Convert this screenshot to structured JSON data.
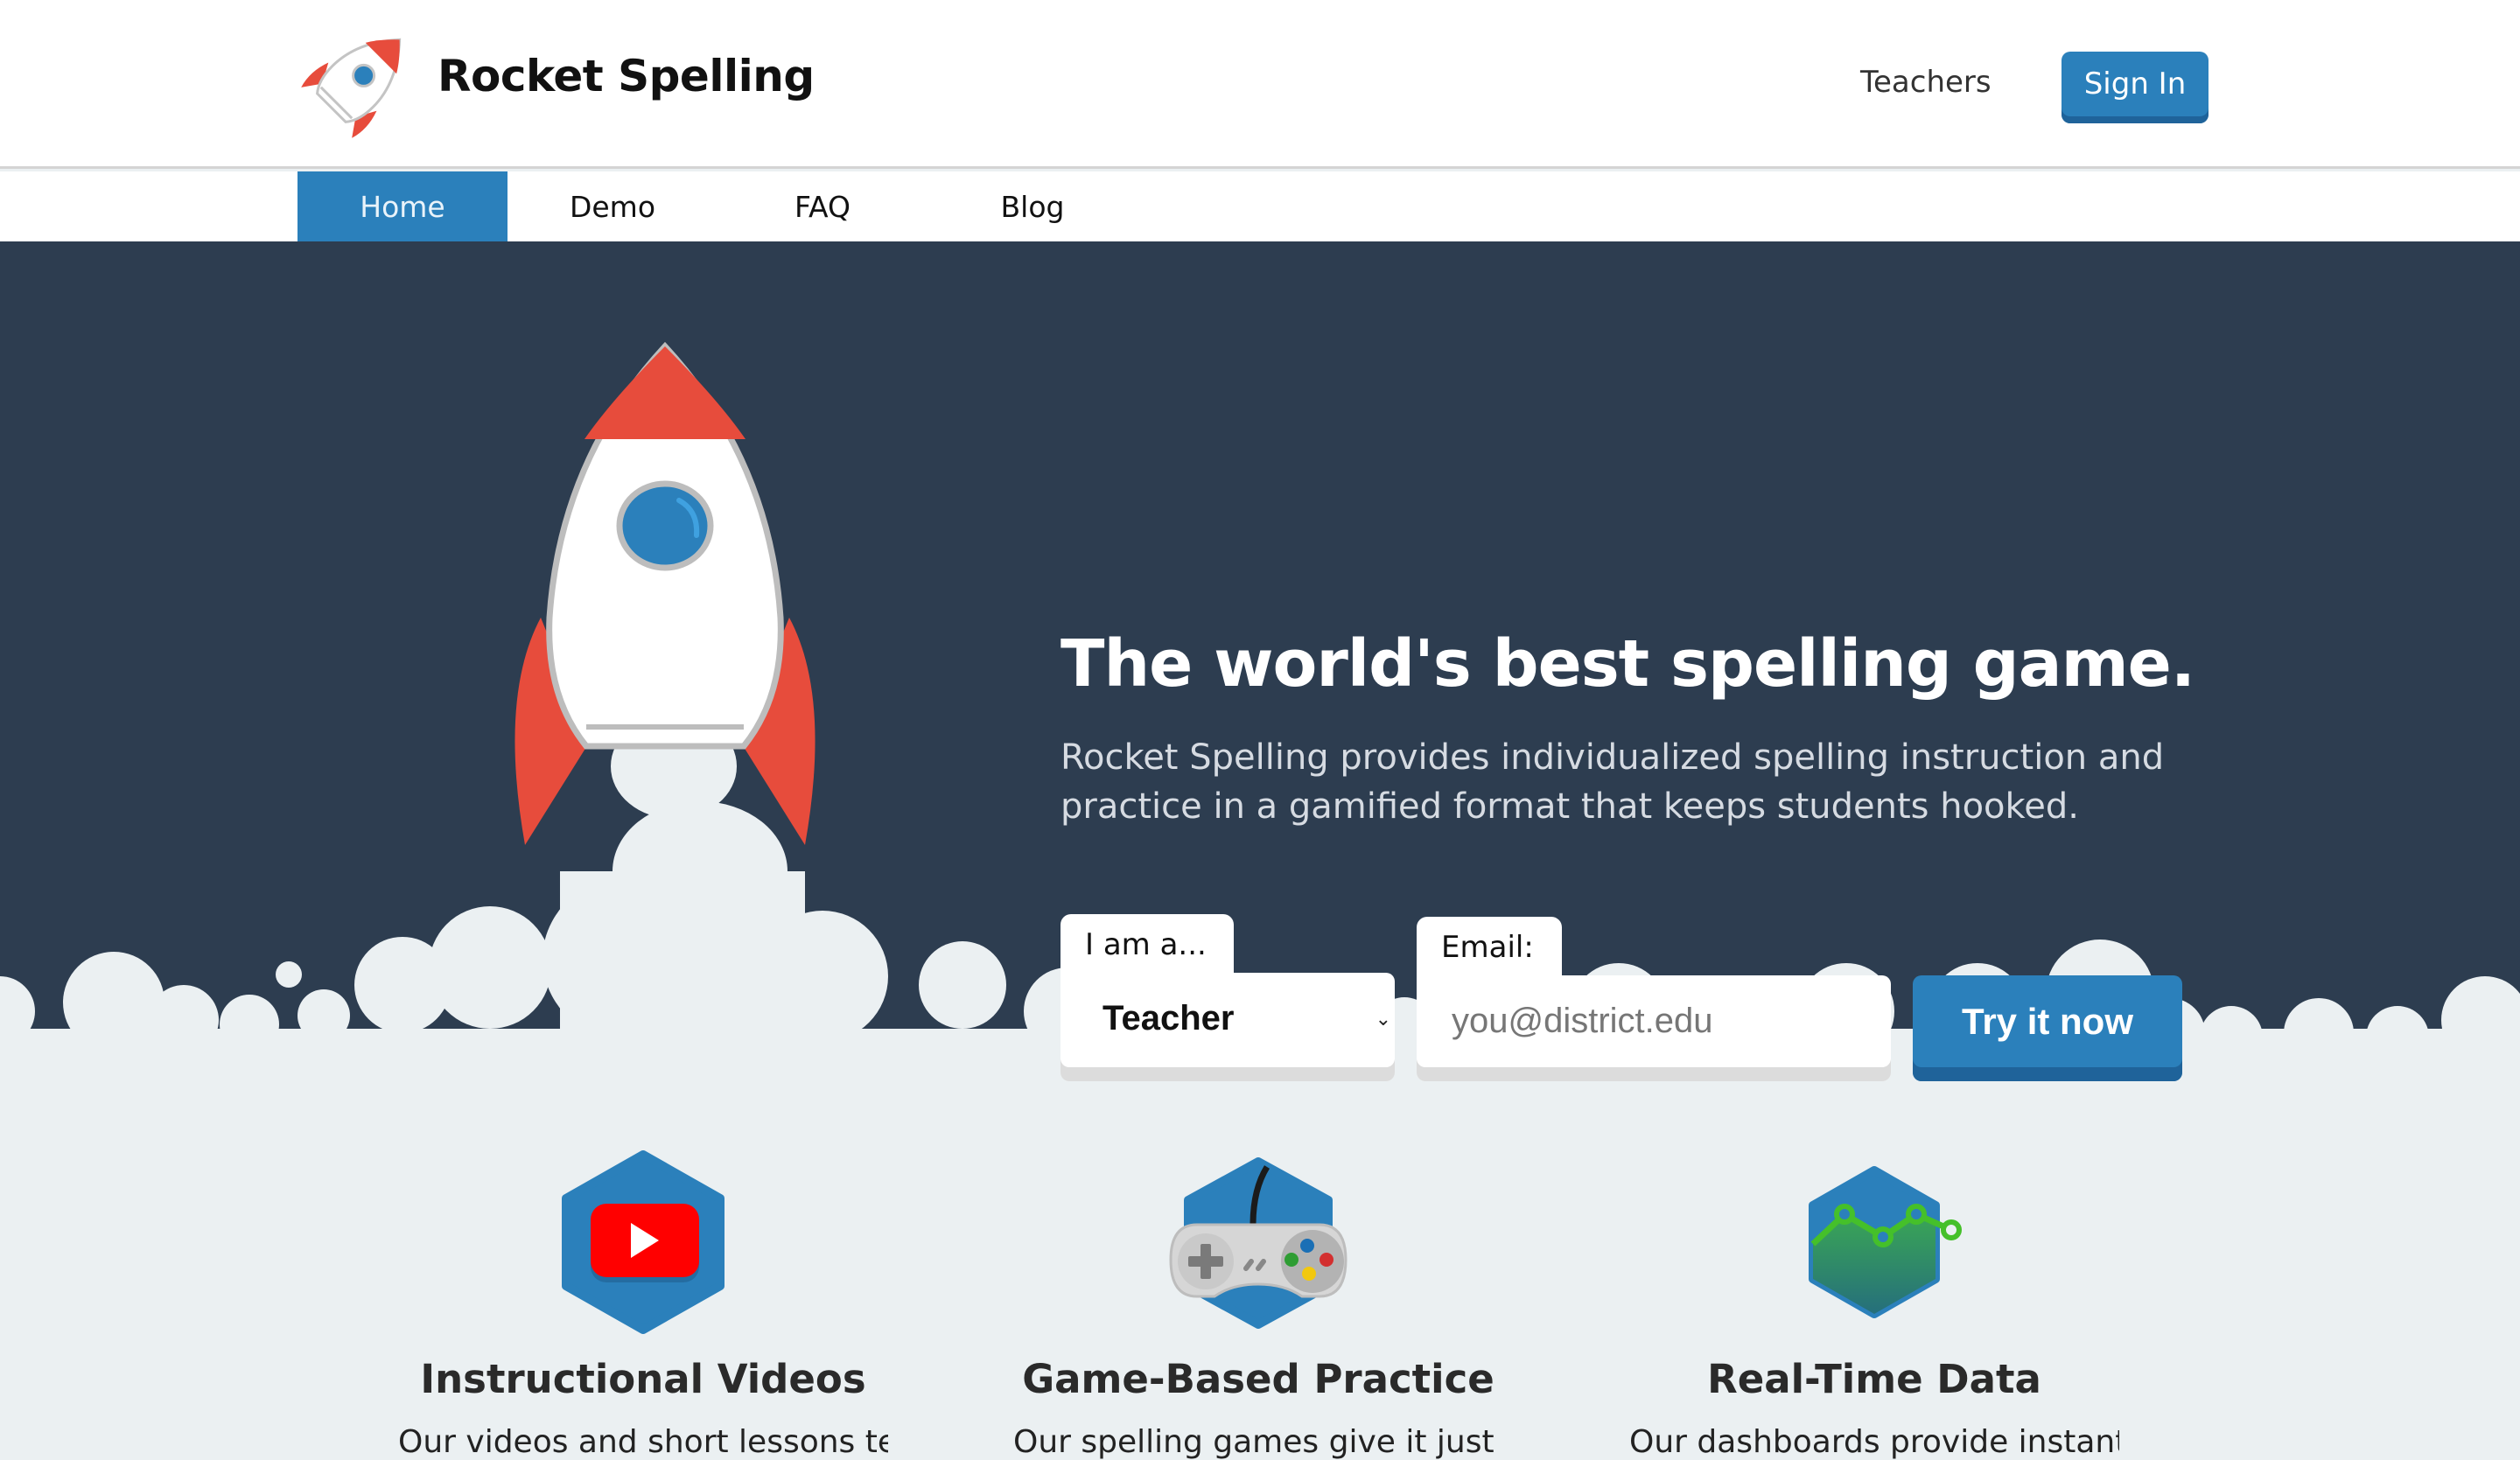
{
  "header": {
    "brand": "Rocket Spelling",
    "teachers_link": "Teachers",
    "signin_label": "Sign In"
  },
  "nav": {
    "items": [
      {
        "label": "Home",
        "active": true
      },
      {
        "label": "Demo",
        "active": false
      },
      {
        "label": "FAQ",
        "active": false
      },
      {
        "label": "Blog",
        "active": false
      }
    ]
  },
  "hero": {
    "headline": "The world's best spelling game.",
    "subtext": "Rocket Spelling provides individualized spelling instruction and practice in a gamified format that keeps students hooked.",
    "role_label": "I am a...",
    "role_value": "Teacher",
    "email_label": "Email:",
    "email_placeholder": "you@district.edu",
    "email_value": "",
    "cta_label": "Try it now"
  },
  "features": [
    {
      "icon": "youtube-play-icon",
      "title": "Instructional Videos",
      "desc": "Our videos and short lessons teach"
    },
    {
      "icon": "gamepad-icon",
      "title": "Game-Based Practice",
      "desc": "Our spelling games give it just enough"
    },
    {
      "icon": "line-chart-icon",
      "title": "Real-Time Data",
      "desc": "Our dashboards provide instant"
    }
  ],
  "colors": {
    "brand_blue": "#2b80bb",
    "hero_bg": "#2d3d50",
    "rocket_red": "#e74c3c",
    "cloud": "#ebf0f2"
  }
}
